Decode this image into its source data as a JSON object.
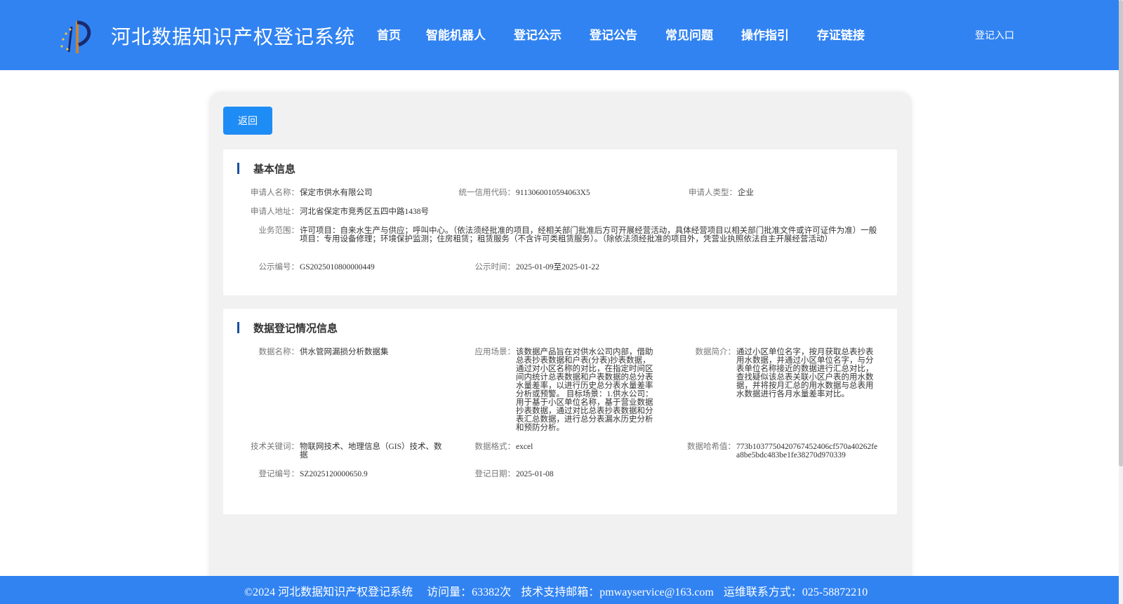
{
  "header": {
    "site_title": "河北数据知识产权登记系统",
    "nav": [
      "首页",
      "智能机器人",
      "登记公示",
      "登记公告",
      "常见问题",
      "操作指引",
      "存证链接"
    ],
    "login_link": "登记入口",
    "background_color": "#3183f2"
  },
  "main": {
    "back_button": "返回",
    "basic_info": {
      "title": "基本信息",
      "applicant_name_label": "申请人名称：",
      "applicant_name": "保定市供水有限公司",
      "credit_code_label": "统一信用代码：",
      "credit_code": "9113060010594063X5",
      "applicant_type_label": "申请人类型：",
      "applicant_type": "企业",
      "address_label": "申请人地址：",
      "address": "河北省保定市竞秀区五四中路1438号",
      "business_scope_label": "业务范围：",
      "business_scope": "许可项目：自来水生产与供应；呼叫中心。（依法须经批准的项目，经相关部门批准后方可开展经营活动，具体经营项目以相关部门批准文件或许可证件为准）一般项目：专用设备修理；环境保护监测；住房租赁；租赁服务（不含许可类租赁服务）。（除依法须经批准的项目外，凭营业执照依法自主开展经营活动）",
      "notice_no_label": "公示编号：",
      "notice_no": "GS2025010800000449",
      "notice_time_label": "公示时间：",
      "notice_time": "2025-01-09至2025-01-22"
    },
    "data_info": {
      "title": "数据登记情况信息",
      "data_name_label": "数据名称：",
      "data_name": "供水管网漏损分析数据集",
      "scenario_label": "应用场景：",
      "scenario": "该数据产品旨在对供水公司内部，借助总表抄表数据和户表(分表)抄表数据，通过对小区名称的对比，在指定时间区间内统计总表数据和户表数据的总分表水量差率，以进行历史总分表水量差率分析或预警。 目标场景：1.供水公司：用于基于小区单位名称，基于营业数据抄表数据，通过对比总表抄表数据和分表汇总数据，进行总分表漏水历史分析和预防分析。",
      "summary_label": "数据简介：",
      "summary": "通过小区单位名字，按月获取总表抄表用水数据，并通过小区单位名字，与分表单位名称接近的数据进行汇总对比，查找疑似该总表关联小区户表的用水数据，并将按月汇总的用水数据与总表用水数据进行各月水量差率对比。",
      "keywords_label": "技术关键词：",
      "keywords": "物联网技术、地理信息（GIS）技术、数据",
      "format_label": "数据格式：",
      "format": "excel",
      "hash_label": "数据哈希值：",
      "hash": "773b103775042076745240​6cf570a40262fea8be5bdc483be1fe38270d970339",
      "reg_no_label": "登记编号：",
      "reg_no": "SZ2025120000650.9",
      "reg_date_label": "登记日期：",
      "reg_date": "2025-01-08"
    }
  },
  "footer": {
    "copyright": "©2024 河北数据知识产权登记系统",
    "visits": "访问量：63382次",
    "email": "技术支持邮箱：pmwayservice@163.com",
    "phone": "运维联系方式：025-58872210"
  }
}
